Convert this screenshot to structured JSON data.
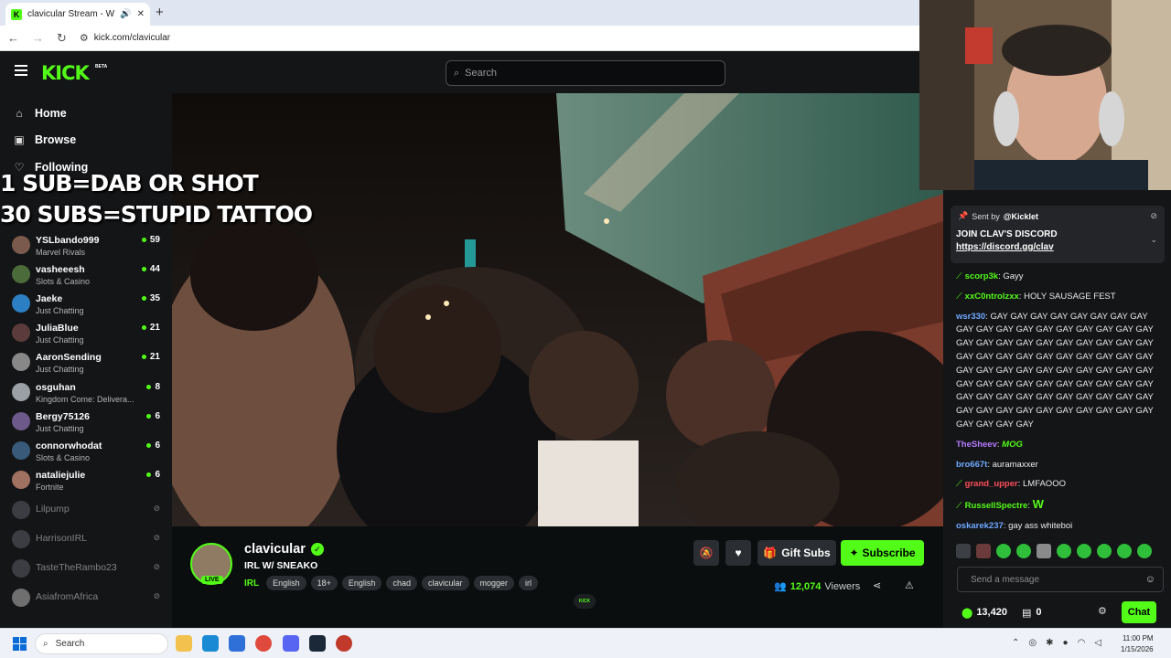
{
  "browser": {
    "tab_title": "clavicular Stream - Watch L",
    "url": "kick.com/clavicular",
    "new_tab_icon": "+"
  },
  "kick": {
    "logo": "KICK",
    "logo_badge": "BETA",
    "search_placeholder": "Search"
  },
  "sidebar": {
    "nav": [
      {
        "label": "Home",
        "icon": "home-icon"
      },
      {
        "label": "Browse",
        "icon": "browse-icon"
      },
      {
        "label": "Following",
        "icon": "heart-icon"
      }
    ],
    "channels": [
      {
        "name": "YSLbando999",
        "category": "Marvel Rivals",
        "viewers": "59",
        "live": true
      },
      {
        "name": "vasheeesh",
        "category": "Slots & Casino",
        "viewers": "44",
        "live": true
      },
      {
        "name": "Jaeke",
        "category": "Just Chatting",
        "viewers": "35",
        "live": true
      },
      {
        "name": "JuliaBlue",
        "category": "Just Chatting",
        "viewers": "21",
        "live": true
      },
      {
        "name": "AaronSending",
        "category": "Just Chatting",
        "viewers": "21",
        "live": true
      },
      {
        "name": "osguhan",
        "category": "Kingdom Come: Delivera...",
        "viewers": "8",
        "live": true
      },
      {
        "name": "Bergy75126",
        "category": "Just Chatting",
        "viewers": "6",
        "live": true
      },
      {
        "name": "connorwhodat",
        "category": "Slots & Casino",
        "viewers": "6",
        "live": true
      },
      {
        "name": "nataliejulie",
        "category": "Fortnite",
        "viewers": "6",
        "live": true
      },
      {
        "name": "Lilpump",
        "category": "",
        "viewers": "",
        "live": false
      },
      {
        "name": "HarrisonIRL",
        "category": "",
        "viewers": "",
        "live": false
      },
      {
        "name": "TasteTheRambo23",
        "category": "",
        "viewers": "",
        "live": false
      },
      {
        "name": "AsiafromAfrica",
        "category": "",
        "viewers": "",
        "live": false
      }
    ]
  },
  "video": {
    "overlay_line1": "1 SUB=DAB OR SHOT",
    "overlay_line2": "30 SUBS=STUPID TATTOO"
  },
  "channel": {
    "name": "clavicular",
    "live_label": "LIVE",
    "title": "IRL W/ SNEAKO",
    "category": "IRL",
    "tags": [
      "English",
      "18+",
      "English",
      "chad",
      "clavicular",
      "mogger",
      "irl"
    ],
    "gift_label": "Gift Subs",
    "subscribe_label": "Subscribe",
    "viewers_count": "12,074",
    "viewers_label": "Viewers"
  },
  "chat": {
    "pinned": {
      "sent_by": "Sent by",
      "sender": "@Kicklet",
      "title": "JOIN CLAV'S DISCORD",
      "link": "https://discord.gg/clav"
    },
    "messages": [
      {
        "user": "scorp3k",
        "color": "#53fc18",
        "badge": true,
        "text": "Gayy"
      },
      {
        "user": "xxC0ntrolzxx",
        "color": "#53fc18",
        "badge": true,
        "text": "HOLY SAUSAGE FEST"
      },
      {
        "user": "wsr330",
        "color": "#6ea8ff",
        "badge": false,
        "text": "GAY GAY GAY GAY GAY GAY GAY GAY GAY GAY GAY GAY GAY GAY GAY GAY GAY GAY GAY GAY GAY GAY GAY GAY GAY GAY GAY GAY GAY GAY GAY GAY GAY GAY GAY GAY GAY GAY GAY GAY GAY GAY GAY GAY GAY GAY GAY GAY GAY GAY GAY GAY GAY GAY GAY GAY GAY GAY GAY GAY GAY GAY GAY GAY GAY GAY GAY GAY GAY GAY GAY GAY GAY GAY GAY GAY GAY GAY GAY GAY GAY GAY"
      },
      {
        "user": "TheSheev",
        "color": "#b57bff",
        "badge": false,
        "text": "MOG"
      },
      {
        "user": "bro667t",
        "color": "#6ea8ff",
        "badge": false,
        "text": "auramaxxer"
      },
      {
        "user": "grand_upper",
        "color": "#ff4d5a",
        "badge": true,
        "text": "LMFAOOO"
      },
      {
        "user": "RussellSpectre",
        "color": "#53fc18",
        "badge": true,
        "text": "W"
      },
      {
        "user": "oskarek237",
        "color": "#6ea8ff",
        "badge": false,
        "text": "gay ass whiteboi"
      }
    ],
    "input_placeholder": "Send a message",
    "points": "13,420",
    "tickets": "0",
    "chat_button": "Chat"
  },
  "taskbar": {
    "search_placeholder": "Search",
    "time": "11:00 PM",
    "date": "1/15/2026"
  },
  "colors": {
    "accent": "#53fc18",
    "background": "#0b0e0f",
    "panel": "#141517"
  }
}
